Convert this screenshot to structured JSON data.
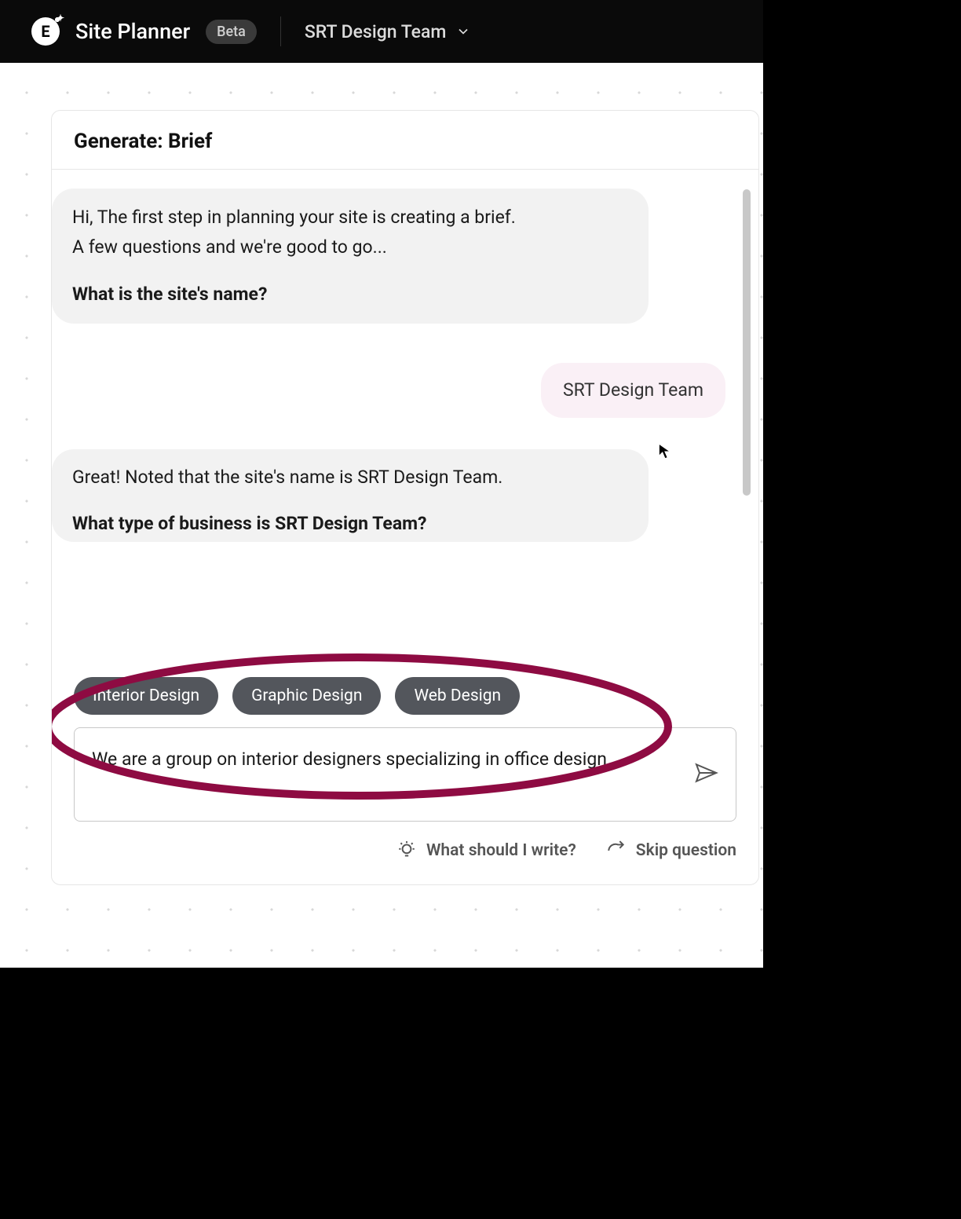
{
  "header": {
    "app_title": "Site Planner",
    "beta_label": "Beta",
    "team_name": "SRT Design Team"
  },
  "panel": {
    "title": "Generate: Brief"
  },
  "chat": {
    "ai1_line1": "Hi, The first step in planning your site is creating a brief.",
    "ai1_line2": "A few questions and we're good to go...",
    "ai1_question": "What is the site's name?",
    "user1": "SRT Design Team",
    "ai2_line1": "Great! Noted that the site's name is SRT Design Team.",
    "ai2_question": "What type of business is SRT Design Team?"
  },
  "chips": {
    "chip1": "Interior Design",
    "chip2": "Graphic Design",
    "chip3": "Web Design"
  },
  "input": {
    "value": "We are a group on interior designers specializing in office design."
  },
  "footer": {
    "hint": "What should I write?",
    "skip": "Skip question"
  },
  "annotation": {
    "color": "#8e0b42"
  }
}
